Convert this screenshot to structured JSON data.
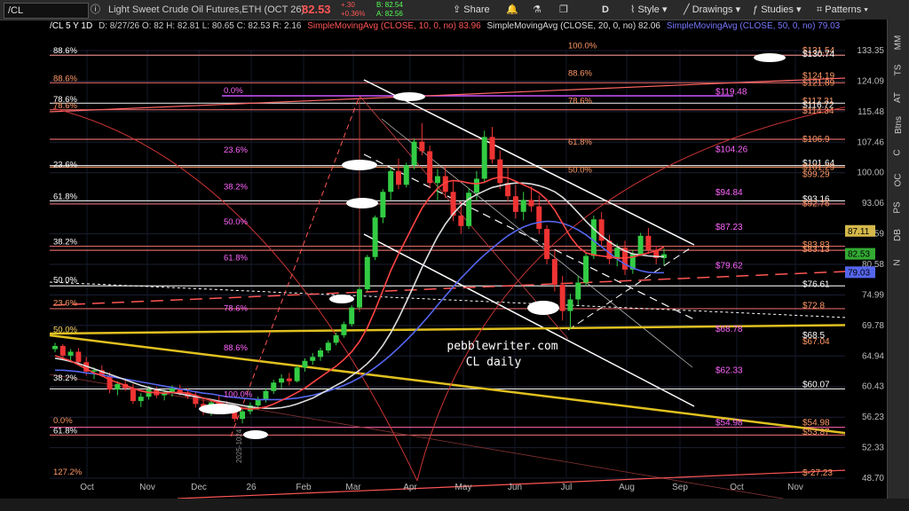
{
  "toolbar": {
    "symbol": "/CL",
    "description": "Light Sweet Crude Oil Futures,ETH (OCT 26)",
    "last": "82.53",
    "change": "+.30",
    "change_pct": "+0.36%",
    "bid": "B: 82.54",
    "ask": "A: 82.56",
    "share_label": "Share",
    "period_label": "D",
    "style_label": "Style",
    "drawings_label": "Drawings",
    "studies_label": "Studies",
    "patterns_label": "Patterns"
  },
  "header": {
    "chart_id": "/CL 5 Y 1D",
    "ohlc": "D: 8/27/26  O: 82  H: 82.81  L: 80.65  C: 82.53  R: 2.16",
    "sma1": "SimpleMovingAvg (CLOSE, 10, 0, no)",
    "sma1_value": "83.96",
    "sma2": "SimpleMovingAvg (CLOSE, 20, 0, no)",
    "sma2_value": "82.06",
    "sma3": "SimpleMovingAvg (CLOSE, 50, 0, no)",
    "sma3_value": "79.03"
  },
  "sidebar": {
    "tabs": [
      "MM",
      "TS",
      "AT",
      "Btns",
      "C",
      "OC",
      "PS",
      "DB",
      "N"
    ]
  },
  "chart_data": {
    "type": "candlestick",
    "x_ticks": [
      "Oct",
      "Nov",
      "Dec",
      "26",
      "Feb",
      "Mar",
      "Apr",
      "May",
      "Jun",
      "Jul",
      "Aug",
      "Sep",
      "Oct",
      "Nov"
    ],
    "y_ticks": [
      48.7,
      52.33,
      56.23,
      60.43,
      64.94,
      69.78,
      74.99,
      80.58,
      86.59,
      93.06,
      100,
      107.46,
      115.48,
      124.09,
      133.35
    ],
    "price_badges": [
      {
        "value": "87.11",
        "color": "#d4b84a"
      },
      {
        "value": "82.53",
        "color": "#33aa33"
      },
      {
        "value": "79.03",
        "color": "#5566ee"
      }
    ],
    "watermark": [
      "pebblewriter.com",
      "CL daily"
    ],
    "vertical_label": "2025-1024",
    "fib_labels_left": [
      {
        "text": "88.6%",
        "y": 131.9,
        "color": "#ffffff"
      },
      {
        "text": "88.6%",
        "y": 123.5,
        "color": "#ff9966"
      },
      {
        "text": "78.6%",
        "y": 117.6,
        "color": "#ffffff"
      },
      {
        "text": "78.6%",
        "y": 115.9,
        "color": "#ff9966"
      },
      {
        "text": "23.6%",
        "y": 100.9,
        "color": "#ffffff"
      },
      {
        "text": "61.8%",
        "y": 93.6,
        "color": "#ffffff"
      },
      {
        "text": "38.2%",
        "y": 84.1,
        "color": "#ffffff"
      },
      {
        "text": "50.0%",
        "y": 76.9,
        "color": "#ffffff"
      },
      {
        "text": "23.6%",
        "y": 72.8,
        "color": "#ff9966"
      },
      {
        "text": "50.0%",
        "y": 68.4,
        "color": "#ffd866"
      },
      {
        "text": "38.2%",
        "y": 61.0,
        "color": "#ffffff"
      },
      {
        "text": "0.0%",
        "y": 55.2,
        "color": "#ff9966"
      },
      {
        "text": "61.8%",
        "y": 53.9,
        "color": "#ffffff"
      },
      {
        "text": "127.2%",
        "y": 48.9,
        "color": "#ff9966"
      }
    ],
    "fib_labels_mid": [
      {
        "text": "0.0%",
        "y": 120.1,
        "color": "#ff66ff"
      },
      {
        "text": "23.6%",
        "y": 104.4,
        "color": "#ff66ff"
      },
      {
        "text": "38.2%",
        "y": 95.7,
        "color": "#ff66ff"
      },
      {
        "text": "50.0%",
        "y": 88.2,
        "color": "#ff66ff"
      },
      {
        "text": "61.8%",
        "y": 81.0,
        "color": "#ff66ff"
      },
      {
        "text": "78.6%",
        "y": 71.9,
        "color": "#ff66ff"
      },
      {
        "text": "88.6%",
        "y": 65.5,
        "color": "#ff66ff"
      },
      {
        "text": "100.0%",
        "y": 58.7,
        "color": "#ff66ff"
      },
      {
        "text": "100.0%",
        "y": 133.5,
        "color": "#ff9966"
      },
      {
        "text": "88.6%",
        "y": 125.1,
        "color": "#ff9966"
      },
      {
        "text": "78.6%",
        "y": 117.3,
        "color": "#ff9966"
      },
      {
        "text": "61.8%",
        "y": 106.4,
        "color": "#ff9966"
      },
      {
        "text": "50.0%",
        "y": 99.6,
        "color": "#ff9966"
      }
    ],
    "price_labels": [
      {
        "text": "$131.54",
        "y": 133.3,
        "color": "#ff9966"
      },
      {
        "text": "$130.74",
        "y": 132.3,
        "color": "#ffffff"
      },
      {
        "text": "$124.19",
        "y": 125.6,
        "color": "#ff9966"
      },
      {
        "text": "$121.89",
        "y": 123.6,
        "color": "#ff9966"
      },
      {
        "text": "$119.48",
        "y": 121.0,
        "color": "#ff66ff"
      },
      {
        "text": "$117.31",
        "y": 118.4,
        "color": "#ff9966"
      },
      {
        "text": "$116.72",
        "y": 117.3,
        "color": "#ffffff"
      },
      {
        "text": "$114.34",
        "y": 115.7,
        "color": "#ff9966"
      },
      {
        "text": "$106.9",
        "y": 108.2,
        "color": "#ff9966"
      },
      {
        "text": "$104.26",
        "y": 105.6,
        "color": "#ff66ff"
      },
      {
        "text": "$101.64",
        "y": 102.3,
        "color": "#ffffff"
      },
      {
        "text": "$101.29",
        "y": 101.3,
        "color": "#ff9966"
      },
      {
        "text": "$99.29",
        "y": 99.6,
        "color": "#ff9966"
      },
      {
        "text": "$94.84",
        "y": 95.5,
        "color": "#ff66ff"
      },
      {
        "text": "$93.16",
        "y": 94.0,
        "color": "#ffffff"
      },
      {
        "text": "$92.76",
        "y": 93.0,
        "color": "#ff9966"
      },
      {
        "text": "$87.23",
        "y": 88.0,
        "color": "#ff66ff"
      },
      {
        "text": "$83.83",
        "y": 84.4,
        "color": "#ff9966"
      },
      {
        "text": "$83.13",
        "y": 83.5,
        "color": "#ff9966"
      },
      {
        "text": "$79.62",
        "y": 80.3,
        "color": "#ff66ff"
      },
      {
        "text": "$76.61",
        "y": 76.9,
        "color": "#ffffff"
      },
      {
        "text": "$72.8",
        "y": 73.1,
        "color": "#ff9966"
      },
      {
        "text": "$68.78",
        "y": 69.2,
        "color": "#ff66ff"
      },
      {
        "text": "$68.5",
        "y": 68.2,
        "color": "#ffffff"
      },
      {
        "text": "$67.04",
        "y": 67.2,
        "color": "#ff9966"
      },
      {
        "text": "$62.33",
        "y": 62.8,
        "color": "#ff66ff"
      },
      {
        "text": "$60.07",
        "y": 60.7,
        "color": "#ffffff"
      },
      {
        "text": "$54.98",
        "y": 55.5,
        "color": "#ff66ff"
      },
      {
        "text": "$54.98",
        "y": 55.5,
        "color": "#ff9966"
      },
      {
        "text": "$53.87",
        "y": 54.3,
        "color": "#ff9966"
      },
      {
        "text": "$-27.23",
        "y": 49.3,
        "color": "#ff9966"
      }
    ],
    "hlines": [
      {
        "y": 131.9,
        "color": "#ff9999"
      },
      {
        "y": 123.6,
        "color": "#ff7777"
      },
      {
        "y": 117.8,
        "color": "#ffffff"
      },
      {
        "y": 116.0,
        "color": "#ff7777"
      },
      {
        "y": 108.2,
        "color": "#ff7777"
      },
      {
        "y": 101.3,
        "color": "#ff9966"
      },
      {
        "y": 101.7,
        "color": "#ffffff"
      },
      {
        "y": 92.9,
        "color": "#ff7777"
      },
      {
        "y": 93.6,
        "color": "#ffffff"
      },
      {
        "y": 84.1,
        "color": "#ff7777"
      },
      {
        "y": 83.3,
        "color": "#ff7777"
      },
      {
        "y": 76.6,
        "color": "#ffffff"
      },
      {
        "y": 72.6,
        "color": "#ff7777"
      },
      {
        "y": 60.1,
        "color": "#ffffff"
      },
      {
        "y": 54.9,
        "color": "#ff66aa"
      },
      {
        "y": 53.9,
        "color": "#ff7777"
      }
    ],
    "candles": [
      [
        66,
        67,
        65.5,
        66.5
      ],
      [
        66.5,
        66.8,
        64.5,
        65
      ],
      [
        65,
        66,
        64,
        65.6
      ],
      [
        65.6,
        66.2,
        63.5,
        64
      ],
      [
        64,
        64.8,
        62,
        62.6
      ],
      [
        62.6,
        63.2,
        61.5,
        62.8
      ],
      [
        62.8,
        63.5,
        61.8,
        62
      ],
      [
        62,
        62.5,
        59.5,
        60
      ],
      [
        60,
        61.2,
        59.2,
        60.8
      ],
      [
        60.8,
        61.5,
        59.8,
        60.2
      ],
      [
        60.2,
        60.8,
        58,
        58.4
      ],
      [
        58.4,
        59.5,
        57.6,
        59
      ],
      [
        59,
        60.5,
        58.6,
        60
      ],
      [
        60,
        60.4,
        58.8,
        59.2
      ],
      [
        59.2,
        60,
        58.5,
        59.6
      ],
      [
        59.6,
        60.6,
        59,
        60.2
      ],
      [
        60.2,
        60.7,
        59.2,
        59.6
      ],
      [
        59.6,
        60.2,
        58.7,
        59
      ],
      [
        59,
        59.8,
        57.5,
        58
      ],
      [
        58,
        58.8,
        56.5,
        57
      ],
      [
        57,
        58.6,
        56.4,
        58.2
      ],
      [
        58.2,
        59.2,
        57.4,
        57.8
      ],
      [
        57.8,
        58.4,
        56.8,
        57.2
      ],
      [
        57.2,
        58,
        55.6,
        56
      ],
      [
        56,
        57.4,
        55.4,
        57
      ],
      [
        57,
        58.2,
        56.6,
        57.8
      ],
      [
        57.8,
        59,
        57.2,
        58.6
      ],
      [
        58.6,
        60.2,
        58.2,
        59.8
      ],
      [
        59.8,
        61.4,
        59.4,
        61
      ],
      [
        61,
        62.2,
        60.2,
        61.6
      ],
      [
        61.6,
        62.4,
        60.6,
        61.2
      ],
      [
        61.2,
        63.5,
        61,
        63.2
      ],
      [
        63.2,
        64.6,
        62.6,
        64.2
      ],
      [
        64.2,
        65.4,
        63.6,
        64.8
      ],
      [
        64.8,
        66.2,
        64.2,
        65.8
      ],
      [
        65.8,
        67.4,
        65.4,
        67
      ],
      [
        67,
        68.6,
        66.6,
        68.2
      ],
      [
        68.2,
        70.4,
        67.8,
        70
      ],
      [
        70,
        73.2,
        69.6,
        72.8
      ],
      [
        72.8,
        76.4,
        72.4,
        76
      ],
      [
        76,
        82.4,
        75.6,
        82
      ],
      [
        82,
        90.4,
        81.4,
        90
      ],
      [
        90,
        96.2,
        88.8,
        95.6
      ],
      [
        95.6,
        101.2,
        93.8,
        100.4
      ],
      [
        100.4,
        103.4,
        96.2,
        97.2
      ],
      [
        97.2,
        102.4,
        96.6,
        101.8
      ],
      [
        101.8,
        108.4,
        100.8,
        107.6
      ],
      [
        107.6,
        112.4,
        104.2,
        105.2
      ],
      [
        105.2,
        106.6,
        96.4,
        97.6
      ],
      [
        97.6,
        100.8,
        93.6,
        99.2
      ],
      [
        99.2,
        101.6,
        94.2,
        95.6
      ],
      [
        95.6,
        98.2,
        89.2,
        90.4
      ],
      [
        90.4,
        93.4,
        86.6,
        88.2
      ],
      [
        88.2,
        96.4,
        87.6,
        95.4
      ],
      [
        95.4,
        100.4,
        93.6,
        98.6
      ],
      [
        98.6,
        110.4,
        97.6,
        108.8
      ],
      [
        108.8,
        111.4,
        102.2,
        103.2
      ],
      [
        103.2,
        105.4,
        96.2,
        97.6
      ],
      [
        97.6,
        101.2,
        93.4,
        94.6
      ],
      [
        94.6,
        97.2,
        89.8,
        91.2
      ],
      [
        91.2,
        95.6,
        89.4,
        93.8
      ],
      [
        93.8,
        96.8,
        91.2,
        92.4
      ],
      [
        92.4,
        94.8,
        86.6,
        87.6
      ],
      [
        87.6,
        88.4,
        80.6,
        81.6
      ],
      [
        81.6,
        83.2,
        75.6,
        76.8
      ],
      [
        76.8,
        78.4,
        70.6,
        72.2
      ],
      [
        72.2,
        75.2,
        69.2,
        74.2
      ],
      [
        74.2,
        78.4,
        73.2,
        77.2
      ],
      [
        77.2,
        82.8,
        76.6,
        82.2
      ],
      [
        82.2,
        90.4,
        81.6,
        89.6
      ],
      [
        89.6,
        91.2,
        84.2,
        85.2
      ],
      [
        85.2,
        86.4,
        80.6,
        81.6
      ],
      [
        81.6,
        84.6,
        80.2,
        83.8
      ],
      [
        83.8,
        85.2,
        78.6,
        79.6
      ],
      [
        79.6,
        83.4,
        78.8,
        82.6
      ],
      [
        82.6,
        86.8,
        82.2,
        86.2
      ],
      [
        86.2,
        87.8,
        82.6,
        83.4
      ],
      [
        83.4,
        84.2,
        80.6,
        81.8
      ],
      [
        81.8,
        83.6,
        80.4,
        82.53
      ]
    ],
    "sma10": [
      65,
      64.6,
      64.2,
      63.6,
      63,
      62.4,
      62,
      61.4,
      61,
      60.6,
      60.2,
      59.8,
      59.6,
      59.6,
      59.5,
      59.6,
      59.6,
      59.5,
      59.2,
      58.8,
      58.5,
      58.2,
      57.9,
      57.6,
      57.4,
      57.3,
      57.4,
      57.6,
      58,
      58.5,
      59,
      59.6,
      60.2,
      61,
      61.8,
      62.6,
      63.4,
      64.4,
      65.6,
      67.2,
      69.4,
      72.4,
      75.8,
      79.4,
      82.6,
      85.6,
      88.8,
      92,
      94.4,
      96.4,
      97.8,
      98.2,
      98,
      97.6,
      97.4,
      97.8,
      98.6,
      99,
      98.8,
      98,
      97.2,
      96.4,
      95.4,
      93.8,
      91.6,
      88.8,
      86,
      84,
      82.8,
      82.4,
      82.2,
      82,
      81.8,
      81.8,
      82,
      82.4,
      82.8,
      83.2,
      83.96
    ],
    "sma20": [
      64.6,
      64.4,
      64.1,
      63.8,
      63.4,
      63,
      62.6,
      62.2,
      61.8,
      61.4,
      61,
      60.6,
      60.3,
      60,
      59.8,
      59.6,
      59.4,
      59.2,
      59,
      58.8,
      58.6,
      58.4,
      58.2,
      58,
      57.8,
      57.6,
      57.5,
      57.4,
      57.4,
      57.5,
      57.7,
      58,
      58.4,
      58.8,
      59.4,
      60,
      60.6,
      61.2,
      62,
      62.8,
      63.8,
      65,
      66.6,
      68.6,
      71,
      73.8,
      76.8,
      80,
      83,
      86,
      88.6,
      90.8,
      92.6,
      94,
      95,
      95.8,
      96.6,
      97,
      97.4,
      97.6,
      97.6,
      97.4,
      97,
      96.4,
      95.6,
      94.4,
      92.8,
      91,
      89.2,
      87.6,
      86.2,
      85,
      84,
      83.2,
      82.6,
      82.4,
      82.2,
      82.1,
      82.06
    ],
    "sma50": [
      62.8,
      62.8,
      62.7,
      62.6,
      62.4,
      62.3,
      62.1,
      61.9,
      61.7,
      61.5,
      61.3,
      61.1,
      60.9,
      60.7,
      60.5,
      60.3,
      60.1,
      59.9,
      59.7,
      59.5,
      59.4,
      59.2,
      59,
      58.9,
      58.8,
      58.7,
      58.6,
      58.6,
      58.6,
      58.6,
      58.7,
      58.8,
      59,
      59.2,
      59.5,
      59.8,
      60.2,
      60.6,
      61.1,
      61.7,
      62.4,
      63.2,
      64.1,
      65.1,
      66.2,
      67.4,
      68.7,
      70.1,
      71.6,
      73.2,
      74.8,
      76.4,
      78,
      79.5,
      81,
      82.4,
      83.7,
      85,
      86.2,
      87.2,
      88,
      88.6,
      89,
      89.2,
      89.1,
      88.8,
      88.2,
      87.4,
      86.4,
      85.2,
      84,
      82.8,
      81.6,
      80.6,
      79.9,
      79.4,
      79.1,
      79,
      79.03
    ]
  }
}
